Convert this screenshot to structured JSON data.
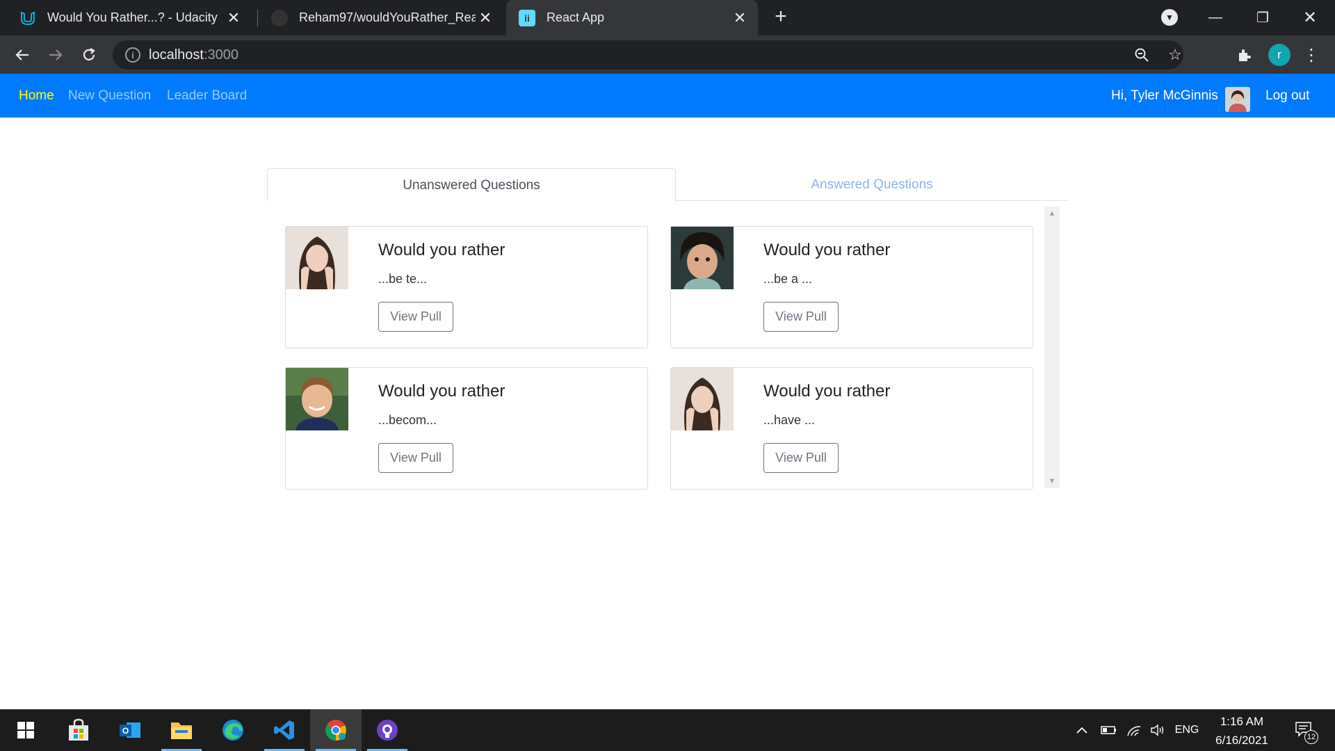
{
  "browser": {
    "tabs": [
      {
        "title": "Would You Rather...? - Udacity"
      },
      {
        "title": "Reham97/wouldYouRather_React"
      },
      {
        "title": "React App"
      }
    ],
    "url_host": "localhost",
    "url_port": ":3000"
  },
  "app": {
    "nav": {
      "home": "Home",
      "new_question": "New Question",
      "leader_board": "Leader Board",
      "greeting": "Hi, Tyler McGinnis",
      "logout": "Log out"
    },
    "tabs": {
      "unanswered": "Unanswered Questions",
      "answered": "Answered Questions"
    },
    "questions": [
      {
        "title": "Would you rather",
        "snippet": "...be te...",
        "button": "View Pull",
        "avatar": "woman-avatar"
      },
      {
        "title": "Would you rather",
        "snippet": "...be a ...",
        "button": "View Pull",
        "avatar": "toddler-avatar"
      },
      {
        "title": "Would you rather",
        "snippet": "...becom...",
        "button": "View Pull",
        "avatar": "boy-avatar"
      },
      {
        "title": "Would you rather",
        "snippet": "...have ...",
        "button": "View Pull",
        "avatar": "woman-avatar"
      }
    ]
  },
  "taskbar": {
    "language": "ENG",
    "time": "1:16 AM",
    "date": "6/16/2021",
    "notifications": "12"
  },
  "colors": {
    "navbar": "#007bff",
    "active_link": "#ffff00",
    "chrome_dark": "#202124"
  }
}
